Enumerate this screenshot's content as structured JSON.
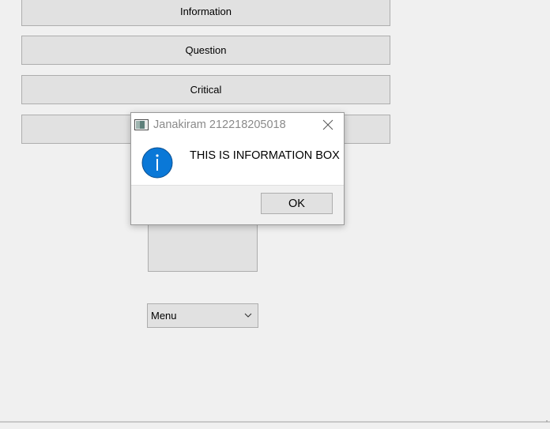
{
  "main": {
    "buttons": {
      "information": "Information",
      "question": "Question",
      "critical": "Critical",
      "warning": ""
    },
    "combo": {
      "selected": "Menu",
      "icon": "chevron-down-icon"
    }
  },
  "dialog": {
    "title": "Janakiram 212218205018",
    "message": "THIS IS INFORMATION BOX",
    "ok_label": "OK",
    "icon": "information-icon",
    "accent_color": "#0078d7"
  }
}
